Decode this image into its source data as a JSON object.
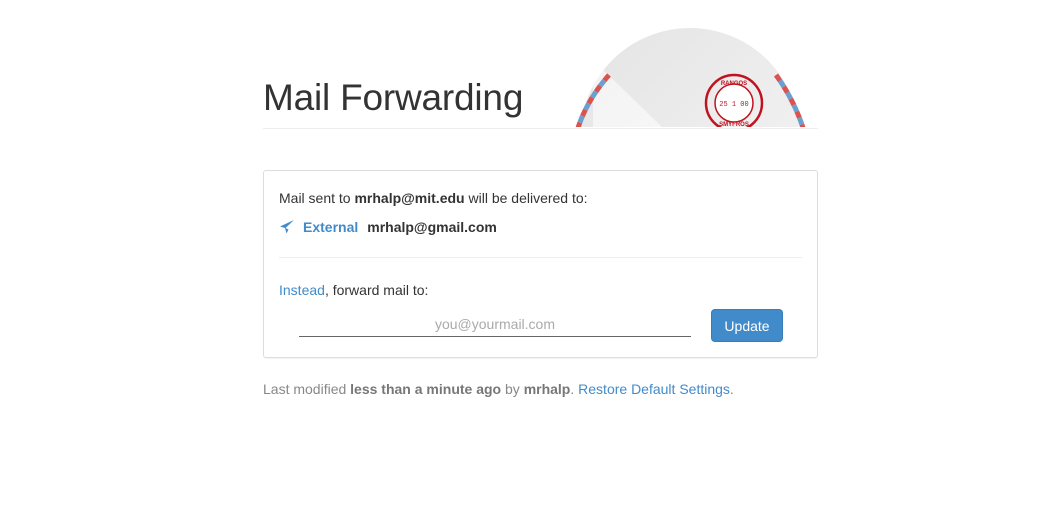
{
  "header": {
    "title": "Mail Forwarding",
    "stamp": {
      "top_text": "RANGOS",
      "date_text": "25 1 00",
      "bottom_text": "SMYFROS"
    }
  },
  "panel": {
    "sent_prefix": "Mail sent to ",
    "source_address": "mrhalp@mit.edu",
    "sent_suffix": " will be delivered to:",
    "destination": {
      "icon": "paper-plane-icon",
      "type": "External",
      "address": "mrhalp@gmail.com"
    },
    "instead_link": "Instead",
    "instead_suffix": ", forward mail to:",
    "forward_input": {
      "value": "",
      "placeholder": "you@yourmail.com"
    },
    "update_label": "Update"
  },
  "footer": {
    "prefix": "Last modified ",
    "when": "less than a minute ago",
    "by": " by ",
    "user": "mrhalp",
    "period": ". ",
    "restore_link": "Restore Default Settings",
    "end": "."
  },
  "colors": {
    "accent": "#428bca",
    "airmail_red": "#d9534f",
    "airmail_blue": "#6a9fcf",
    "stamp_red": "#c0121f"
  }
}
